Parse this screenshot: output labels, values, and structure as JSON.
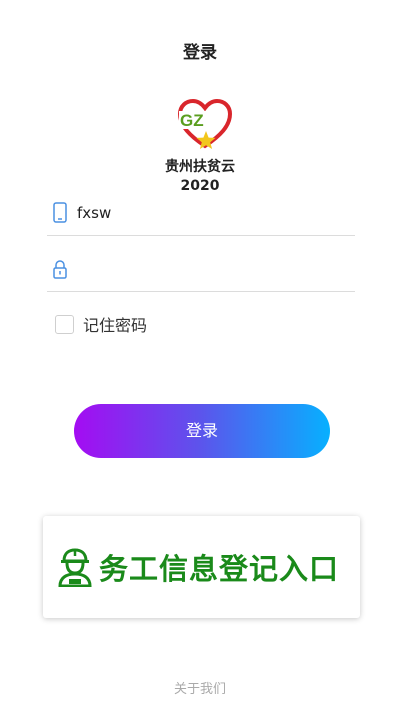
{
  "header": {
    "title": "登录"
  },
  "logo": {
    "letters": "GZ",
    "line1": "贵州扶贫云",
    "line2": "2020"
  },
  "form": {
    "username_value": "fxsw",
    "password_value": "",
    "remember_label": "记住密码",
    "remember_checked": false,
    "login_label": "登录"
  },
  "entry": {
    "label": "务工信息登记入口",
    "icon": "worker-icon"
  },
  "footer": {
    "about_label": "关于我们"
  },
  "colors": {
    "accent_start": "#a40cf2",
    "accent_end": "#07b0ff",
    "entry_green": "#1a8a1a",
    "logo_heart": "#d9262c",
    "logo_star": "#f2c61b",
    "icon_blue": "#4a90e2"
  }
}
